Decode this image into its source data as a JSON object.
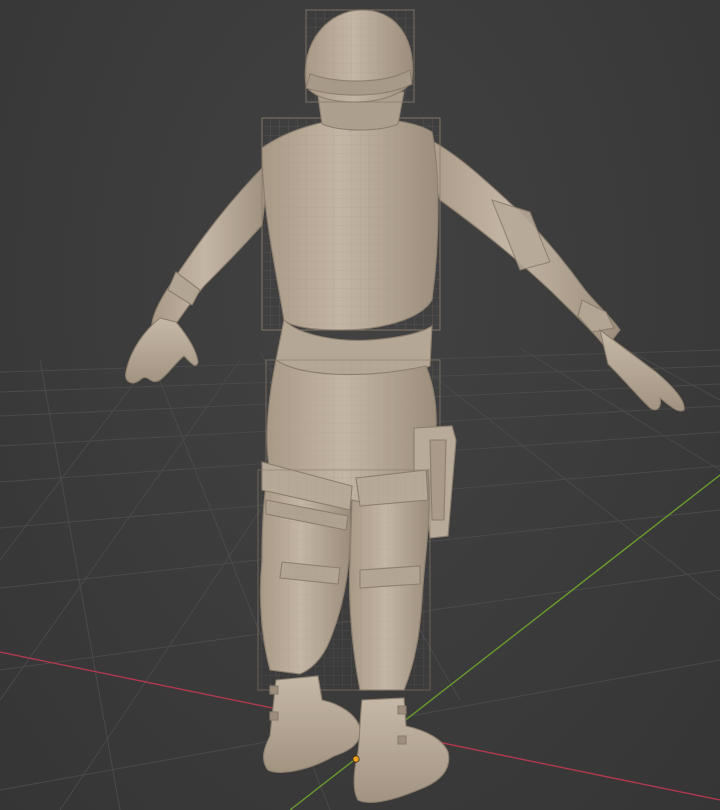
{
  "viewport": {
    "background_color": "#3a3a3a",
    "grid_color": "#4a4a4a",
    "x_axis_color": "#b0394e",
    "y_axis_color": "#6a9a2e",
    "origin_color": "#f0a020",
    "model_color": "#b9aa99",
    "model_shade": "#8f8272",
    "wire_color": "#a29482",
    "object_icon": "character-mesh-icon"
  }
}
